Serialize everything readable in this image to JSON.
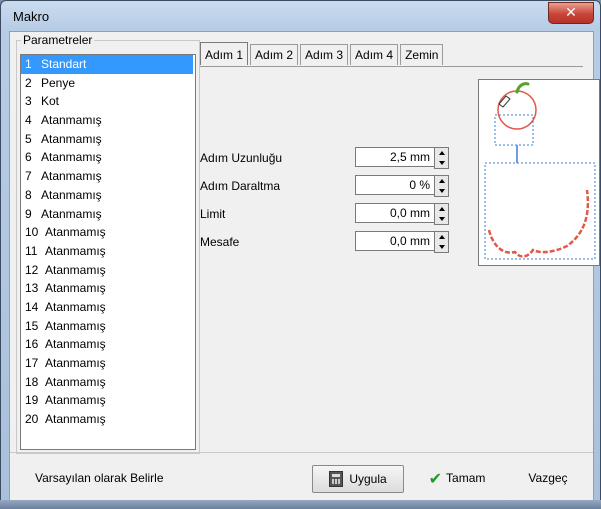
{
  "window": {
    "title": "Makro"
  },
  "parameters": {
    "legend": "Parametreler",
    "items": [
      {
        "num": "1",
        "label": "Standart"
      },
      {
        "num": "2",
        "label": "Penye"
      },
      {
        "num": "3",
        "label": "Kot"
      },
      {
        "num": "4",
        "label": "Atanmamış"
      },
      {
        "num": "5",
        "label": "Atanmamış"
      },
      {
        "num": "6",
        "label": "Atanmamış"
      },
      {
        "num": "7",
        "label": "Atanmamış"
      },
      {
        "num": "8",
        "label": "Atanmamış"
      },
      {
        "num": "9",
        "label": "Atanmamış"
      },
      {
        "num": "10",
        "label": "Atanmamış"
      },
      {
        "num": "11",
        "label": "Atanmamış"
      },
      {
        "num": "12",
        "label": "Atanmamış"
      },
      {
        "num": "13",
        "label": "Atanmamış"
      },
      {
        "num": "14",
        "label": "Atanmamış"
      },
      {
        "num": "15",
        "label": "Atanmamış"
      },
      {
        "num": "16",
        "label": "Atanmamış"
      },
      {
        "num": "17",
        "label": "Atanmamış"
      },
      {
        "num": "18",
        "label": "Atanmamış"
      },
      {
        "num": "19",
        "label": "Atanmamış"
      },
      {
        "num": "20",
        "label": "Atanmamış"
      }
    ],
    "selected": "1 Standart"
  },
  "tabs": [
    "Adım 1",
    "Adım 2",
    "Adım 3",
    "Adım 4",
    "Zemin"
  ],
  "fields": {
    "step_length": {
      "label": "Adım Uzunluğu",
      "value": "2,5 mm"
    },
    "step_narrow": {
      "label": "Adım Daraltma",
      "value": "0 %"
    },
    "limit": {
      "label": "Limit",
      "value": "0,0 mm"
    },
    "distance": {
      "label": "Mesafe",
      "value": "0,0 mm"
    }
  },
  "buttons": {
    "set_default": "Varsayılan olarak Belirle",
    "apply": "Uygula",
    "ok": "Tamam",
    "cancel": "Vazgeç"
  },
  "icons": {
    "close": "close-icon",
    "apply": "calculator-icon",
    "ok": "checkmark-icon",
    "spin_up": "arrow-up-icon",
    "spin_down": "arrow-down-icon"
  },
  "colors": {
    "selection": "#3399ff",
    "close_button": "#c9453a",
    "preview_stitch": "#e05a4a",
    "preview_frame": "#3a7fd8",
    "ok_check": "#1e9e1e"
  }
}
